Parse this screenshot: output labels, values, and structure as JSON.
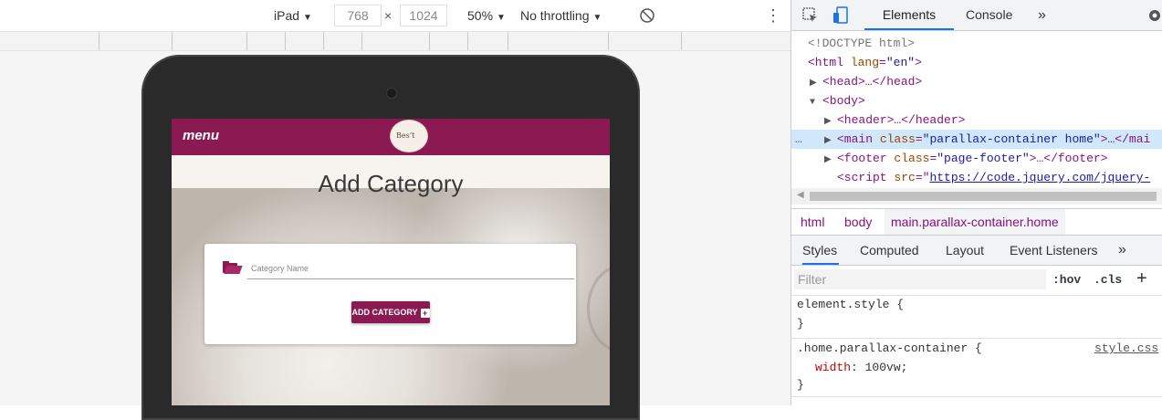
{
  "device_toolbar": {
    "device": "iPad",
    "width": "768",
    "times": "×",
    "height": "1024",
    "zoom": "50%",
    "throttling": "No throttling",
    "caret": "▼",
    "more": "⋮"
  },
  "site": {
    "nav_menu": "menu",
    "logo_text": "Bes’t",
    "page_title": "Add Category",
    "input_placeholder": "Category Name",
    "button_label": "ADD CATEGORY",
    "button_plus": "+",
    "brand_color": "#8b1a52"
  },
  "devtools": {
    "tabs": [
      "Elements",
      "Console",
      "»"
    ],
    "dom": {
      "doctype": "<!DOCTYPE html>",
      "html_open": "<html",
      "html_attr": "lang",
      "html_val": "\"en\"",
      "html_close": ">",
      "head": "<head>…</head>",
      "body": "<body>",
      "header": "<header>…</header>",
      "main_tag": "<main",
      "main_attr": "class",
      "main_val": "\"parallax-container home\"",
      "main_rest": ">…</mai",
      "footer_tag": "<footer",
      "footer_attr": "class",
      "footer_val": "\"page-footer\"",
      "footer_rest": ">…</footer>",
      "script_tag": "<script",
      "script_attr": "src",
      "script_val": "https://code.jquery.com/jquery-",
      "ellipsis": "…"
    },
    "breadcrumbs": [
      "html",
      "body",
      "main.parallax-container.home"
    ],
    "sub_tabs": [
      "Styles",
      "Computed",
      "Layout",
      "Event Listeners",
      "»"
    ],
    "filter_placeholder": "Filter",
    "hov": ":hov",
    "cls": ".cls",
    "plus": "+",
    "rules": {
      "element_style": "element.style {",
      "close_brace": "}",
      "selector": ".home.parallax-container {",
      "prop": "width",
      "value": "100vw;",
      "source": "style.css"
    }
  }
}
